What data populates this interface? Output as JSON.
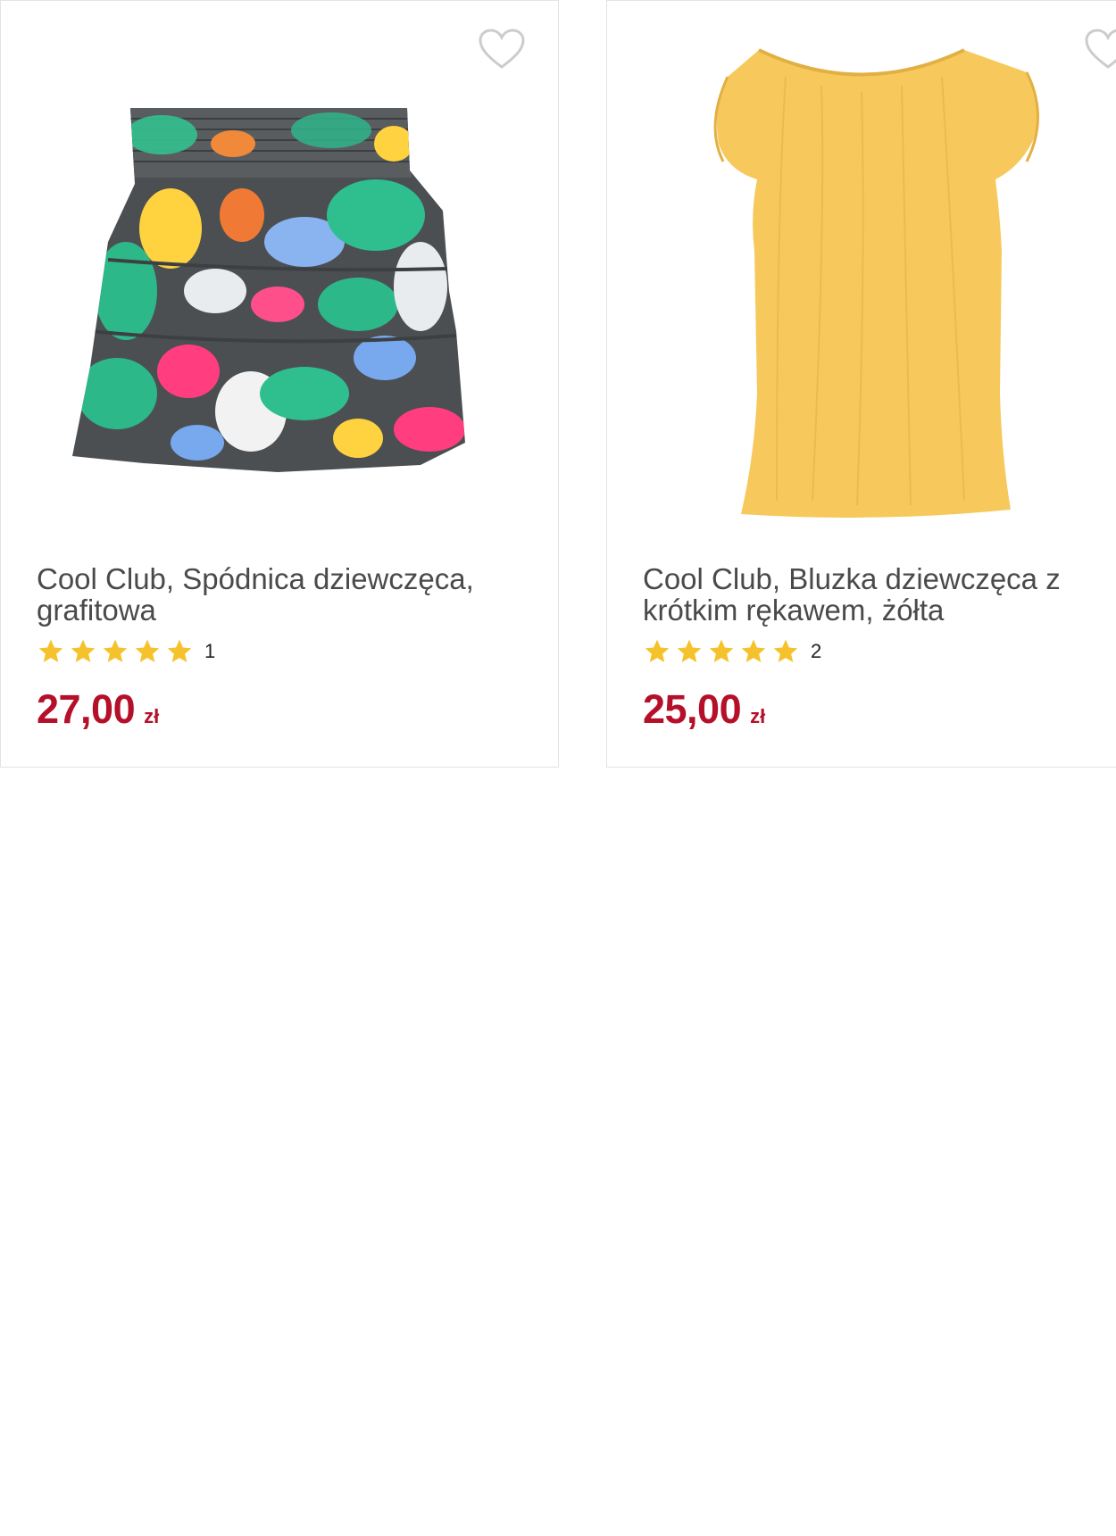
{
  "colors": {
    "price": "#b5102a",
    "title": "#4a4a4a",
    "star": "#f5c22b",
    "border": "#e3e3e3",
    "heart_outline": "#cccccc"
  },
  "products": [
    {
      "image_icon": "floral-skirt-image",
      "title": "Cool Club, Spódnica dziewczęca, grafitowa",
      "rating": 5,
      "rating_count": "1",
      "price": "27,00",
      "currency": "zł",
      "favorite_icon": "heart-outline-icon"
    },
    {
      "image_icon": "yellow-blouse-image",
      "title": "Cool Club, Bluzka dziewczęca z krótkim rękawem, żółta",
      "rating": 5,
      "rating_count": "2",
      "price": "25,00",
      "currency": "zł",
      "favorite_icon": "heart-outline-icon"
    }
  ]
}
